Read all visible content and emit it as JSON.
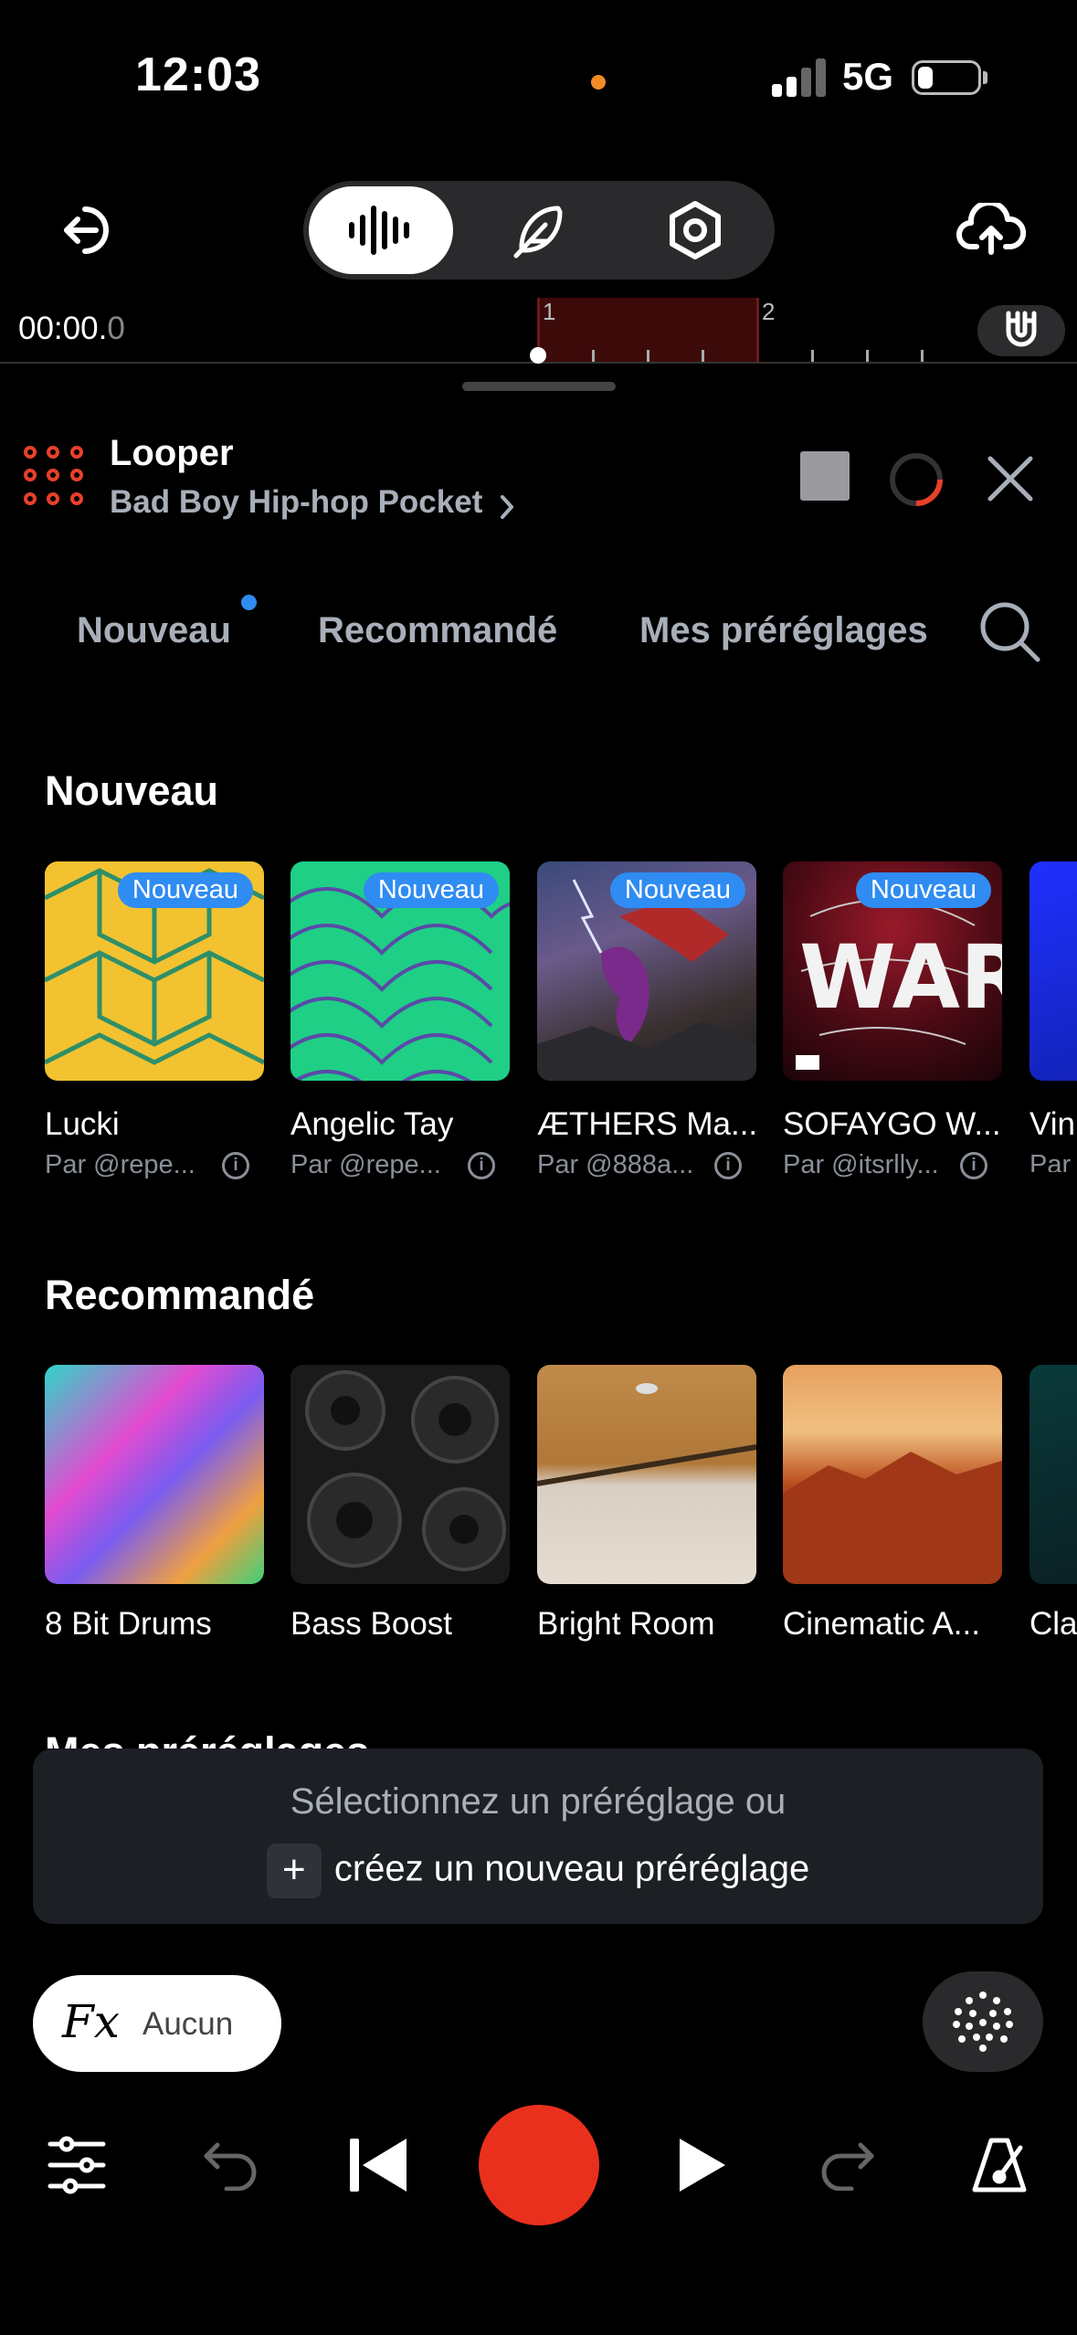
{
  "status": {
    "time": "12:03",
    "network": "5G"
  },
  "timeline": {
    "time_main": "00:00.",
    "time_fraction": "0",
    "bar_1": "1",
    "bar_2": "2"
  },
  "looper": {
    "title": "Looper",
    "preset": "Bad Boy Hip-hop Pocket"
  },
  "tabs": [
    "Nouveau",
    "Recommandé",
    "Mes préréglages"
  ],
  "sections": {
    "new": {
      "title": "Nouveau",
      "badge": "Nouveau",
      "items": [
        {
          "title": "Lucki",
          "author": "Par @repe..."
        },
        {
          "title": "Angelic Tay",
          "author": "Par @repe..."
        },
        {
          "title": "ÆTHERS Ma...",
          "author": "Par @888a..."
        },
        {
          "title": "SOFAYGO W...",
          "author": "Par @itsrlly..."
        },
        {
          "title": "Vin",
          "author": "Par"
        }
      ]
    },
    "recommended": {
      "title": "Recommandé",
      "items": [
        {
          "title": "8 Bit Drums"
        },
        {
          "title": "Bass Boost"
        },
        {
          "title": "Bright Room"
        },
        {
          "title": "Cinematic A..."
        },
        {
          "title": "Cla"
        }
      ]
    },
    "mine": {
      "title": "Mes préréglages"
    }
  },
  "prompt": {
    "line1": "Sélectionnez un préréglage ou",
    "plus": "+",
    "line2": "créez un nouveau préréglage"
  },
  "fx": {
    "symbol": "Fx",
    "value": "Aucun"
  },
  "art": {
    "war_text": "WAR"
  },
  "colors": {
    "accent_blue": "#2f8cf2",
    "record_red": "#e9301d",
    "looper_red": "#e8402a",
    "background": "#000000"
  }
}
